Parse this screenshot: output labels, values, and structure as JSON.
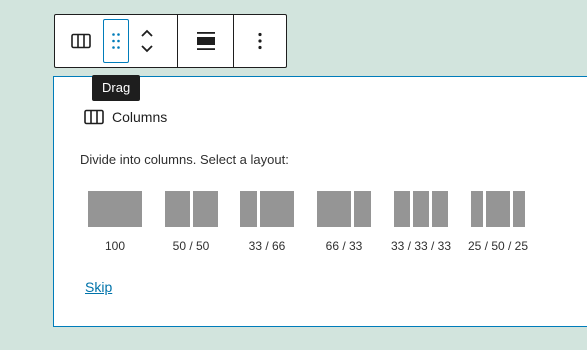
{
  "toolbar": {
    "buttons": [
      {
        "icon": "columns-icon",
        "label": "Columns"
      },
      {
        "icon": "drag-handle-icon",
        "label": "Drag"
      },
      {
        "icon": "move-up-down-icon",
        "label": "Move"
      },
      {
        "icon": "align-icon",
        "label": "Align"
      },
      {
        "icon": "more-options-icon",
        "label": "Options"
      }
    ]
  },
  "tooltip": {
    "text": "Drag"
  },
  "placeholder": {
    "label": "Columns",
    "instructions": "Divide into columns. Select a layout:",
    "variations": [
      {
        "label": "100",
        "columns": [
          100
        ]
      },
      {
        "label": "50 / 50",
        "columns": [
          50,
          50
        ]
      },
      {
        "label": "33 / 66",
        "columns": [
          33,
          66
        ]
      },
      {
        "label": "66 / 33",
        "columns": [
          66,
          33
        ]
      },
      {
        "label": "33 / 33 / 33",
        "columns": [
          33,
          33,
          33
        ]
      },
      {
        "label": "25 / 50 / 25",
        "columns": [
          25,
          50,
          25
        ]
      }
    ],
    "skip_label": "Skip"
  },
  "colors": {
    "background": "#d2e4dd",
    "accent": "#007cba",
    "column_fill": "#959595",
    "link": "#0073aa"
  }
}
